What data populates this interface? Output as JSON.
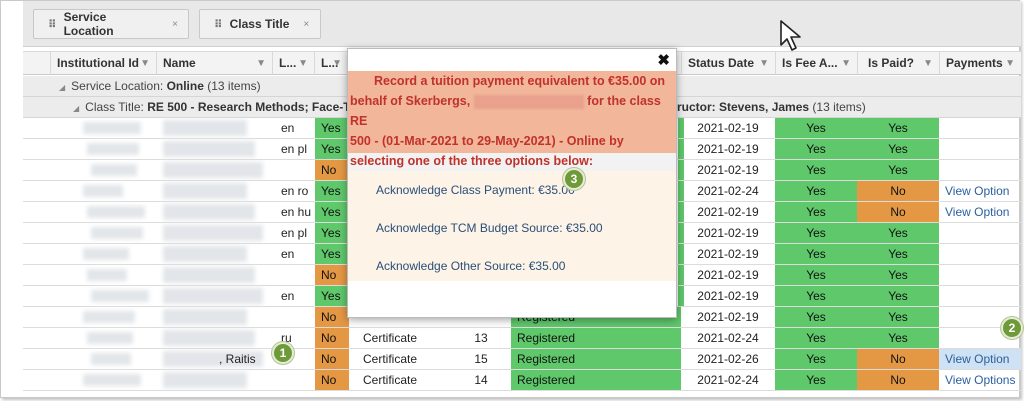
{
  "group_panel": {
    "chips": [
      {
        "label": "Service Location",
        "close": "×"
      },
      {
        "label": "Class Title",
        "close": "×"
      }
    ]
  },
  "header": {
    "columns": [
      {
        "label": "Institutional Id"
      },
      {
        "label": "Name"
      },
      {
        "label": "L..."
      },
      {
        "label": "L..."
      },
      {
        "label": "Status Date"
      },
      {
        "label": "Is Fee A..."
      },
      {
        "label": "Is Paid?"
      },
      {
        "label": "Payments"
      }
    ]
  },
  "groups": {
    "service_location_prefix": "Service Location:",
    "service_location_value": "Online",
    "service_location_count": "(13 items)",
    "class_title_prefix": "Class Title:",
    "class_title_value": "RE 500 - Research Methods; Face-To",
    "class_title_tail": "ructor: Stevens, James",
    "class_title_count": "(13 items)"
  },
  "rows": [
    {
      "lang": "en",
      "l2": "Yes",
      "date": "2021-02-19",
      "fee": "Yes",
      "paid": "Yes",
      "pay": ""
    },
    {
      "lang": "en pl",
      "l2": "Yes",
      "date": "2021-02-19",
      "fee": "Yes",
      "paid": "Yes",
      "pay": ""
    },
    {
      "lang": "",
      "l2": "No",
      "date": "2021-02-19",
      "fee": "Yes",
      "paid": "Yes",
      "pay": ""
    },
    {
      "lang": "en ro",
      "l2": "Yes",
      "date": "2021-02-24",
      "fee": "Yes",
      "paid": "No",
      "pay": "View Option"
    },
    {
      "lang": "en hu",
      "l2": "Yes",
      "date": "2021-02-19",
      "fee": "Yes",
      "paid": "No",
      "pay": "View Option"
    },
    {
      "lang": "en pl",
      "l2": "Yes",
      "date": "2021-02-19",
      "fee": "Yes",
      "paid": "Yes",
      "pay": ""
    },
    {
      "lang": "en",
      "l2": "Yes",
      "date": "2021-02-19",
      "fee": "Yes",
      "paid": "Yes",
      "pay": ""
    },
    {
      "lang": "",
      "l2": "No",
      "date": "2021-02-19",
      "fee": "Yes",
      "paid": "Yes",
      "pay": ""
    },
    {
      "lang": "en",
      "l2": "Yes",
      "date": "2021-02-19",
      "fee": "Yes",
      "paid": "Yes",
      "pay": ""
    },
    {
      "lang": "",
      "l2": "No",
      "type": "",
      "num": "",
      "status": "Registered",
      "date": "2021-02-19",
      "fee": "Yes",
      "paid": "Yes",
      "pay": ""
    },
    {
      "lang": "ru",
      "l2": "No",
      "type": "Certificate",
      "num": "13",
      "status": "Registered",
      "date": "2021-02-24",
      "fee": "Yes",
      "paid": "Yes",
      "pay": ""
    },
    {
      "name": ", Raitis",
      "lang": "",
      "l2": "No",
      "type": "Certificate",
      "num": "15",
      "status": "Registered",
      "date": "2021-02-26",
      "fee": "Yes",
      "paid": "No",
      "pay": "View Option"
    },
    {
      "lang": "",
      "l2": "No",
      "type": "Certificate",
      "num": "14",
      "status": "Registered",
      "date": "2021-02-24",
      "fee": "Yes",
      "paid": "No",
      "pay": "View Options"
    }
  ],
  "modal": {
    "close": "✖",
    "line1": "Record a tuition payment equivalent to €35.00 on",
    "line2a": "behalf of Skerbergs,",
    "line2b": "for the class RE",
    "line3": "500 - (01-Mar-2021 to 29-May-2021) - Online by",
    "line4": "selecting one of the three options below:",
    "options": [
      "Acknowledge Class Payment: €35.00",
      "Acknowledge TCM Budget Source: €35.00",
      "Acknowledge Other Source: €35.00"
    ]
  },
  "badges": [
    "1",
    "2",
    "3"
  ],
  "colors": {
    "yes": "#5fc86b",
    "no": "#e49844",
    "message_bg": "#f2b69b",
    "message_text": "#c0322b",
    "badge": "#6f9a3a"
  }
}
